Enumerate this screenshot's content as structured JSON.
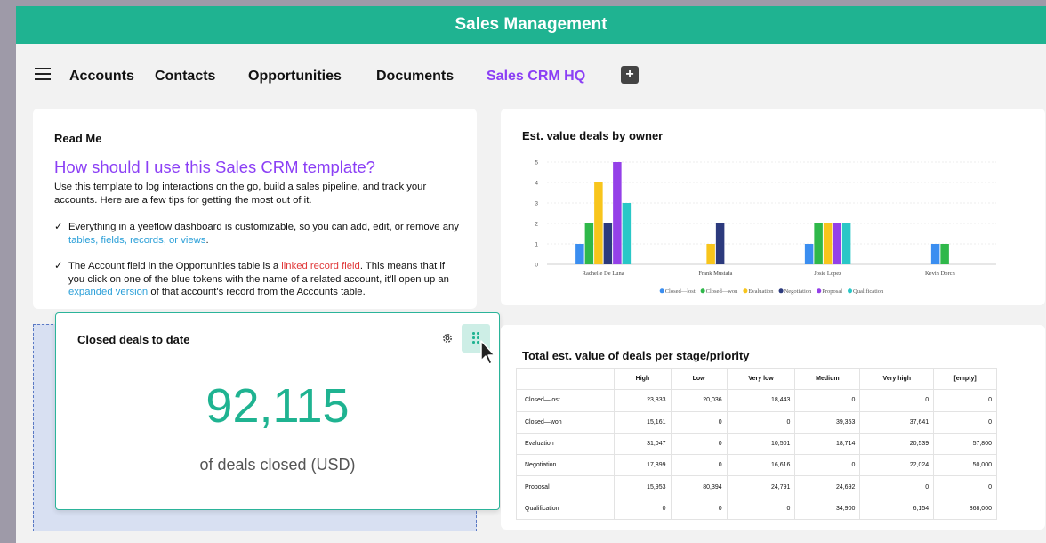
{
  "app": {
    "title": "Sales Management"
  },
  "nav": {
    "tabs": [
      {
        "label": "Accounts"
      },
      {
        "label": "Contacts"
      },
      {
        "label": "Opportunities"
      },
      {
        "label": "Documents"
      },
      {
        "label": "Sales CRM HQ",
        "active": true
      }
    ],
    "add_label": "+"
  },
  "readme": {
    "title": "Read Me",
    "subtitle": "How should I use this Sales CRM template?",
    "intro": "Use this template to log interactions on the go, build a sales pipeline, and track your accounts. Here are a few tips for getting the most out of it.",
    "tip1": {
      "before": "Everything in a yeeflow dashboard is customizable, so you can add, edit, or remove any ",
      "link": "tables, fields, records, or views",
      "after": "."
    },
    "tip2": {
      "before": "The Account field in the Opportunities table is a",
      "link1": " linked record field",
      "middle": ". This means that if you click on one of the blue tokens with the name of a related account, it'll open up an",
      "link2": " expanded version",
      "after": " of that account's record from the Accounts table."
    }
  },
  "kpi": {
    "title": "Closed deals to date",
    "value": "92,115",
    "caption": "of deals closed (USD)"
  },
  "chart_data": [
    {
      "type": "bar",
      "title": "Est. value deals by owner",
      "categories": [
        "Rachelle De Luna",
        "Frank Mustafa",
        "Josie Lopez",
        "Kevin Dorch"
      ],
      "ylim": [
        0,
        5
      ],
      "yticks": [
        0,
        1,
        2,
        3,
        4,
        5
      ],
      "grid": true,
      "legend_position": "bottom",
      "series": [
        {
          "name": "Closed—lost",
          "color": "#3b8ef0",
          "values": [
            1,
            0,
            1,
            1
          ]
        },
        {
          "name": "Closed—won",
          "color": "#2fb84a",
          "values": [
            2,
            0,
            2,
            1
          ]
        },
        {
          "name": "Evaluation",
          "color": "#f8c51c",
          "values": [
            4,
            1,
            2,
            0
          ]
        },
        {
          "name": "Negotiation",
          "color": "#2c3a7d",
          "values": [
            2,
            2,
            0,
            0
          ]
        },
        {
          "name": "Proposal",
          "color": "#9440e8",
          "values": [
            5,
            0,
            2,
            0
          ]
        },
        {
          "name": "Qualification",
          "color": "#29c7c7",
          "values": [
            3,
            0,
            2,
            0
          ]
        }
      ]
    },
    {
      "type": "table",
      "title": "Total est. value of deals per stage/priority",
      "columns": [
        "",
        "High",
        "Low",
        "Very low",
        "Medium",
        "Very high",
        "[empty]"
      ],
      "rows": [
        [
          "Closed—lost",
          "23,833",
          "20,036",
          "18,443",
          "0",
          "0",
          "0"
        ],
        [
          "Closed—won",
          "15,161",
          "0",
          "0",
          "39,353",
          "37,641",
          "0"
        ],
        [
          "Evaluation",
          "31,047",
          "0",
          "10,501",
          "18,714",
          "20,539",
          "57,800"
        ],
        [
          "Negotiation",
          "17,899",
          "0",
          "16,616",
          "0",
          "22,024",
          "50,000"
        ],
        [
          "Proposal",
          "15,953",
          "80,394",
          "24,791",
          "24,692",
          "0",
          "0"
        ],
        [
          "Qualification",
          "0",
          "0",
          "0",
          "34,900",
          "6,154",
          "368,000"
        ]
      ]
    }
  ]
}
